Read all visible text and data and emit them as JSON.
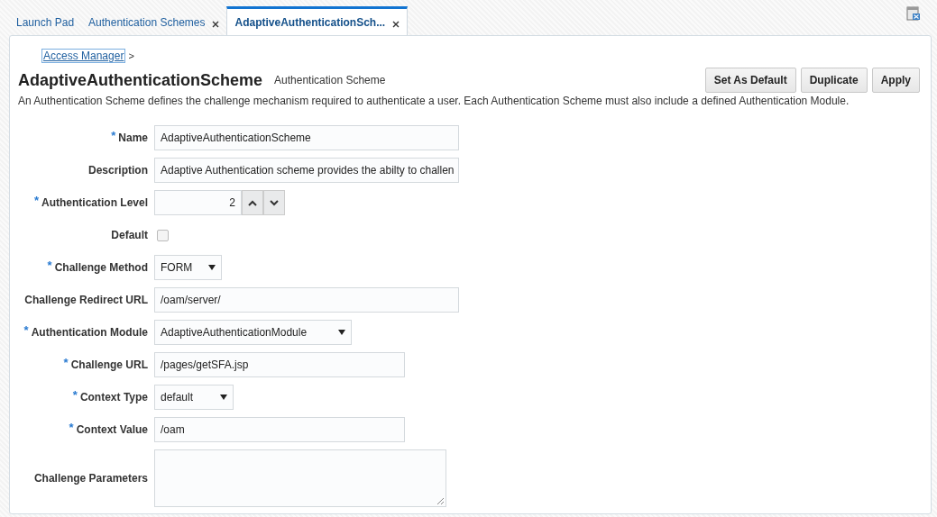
{
  "tabs": [
    {
      "label": "Launch Pad",
      "selected": false,
      "closable": false
    },
    {
      "label": "Authentication Schemes",
      "selected": false,
      "closable": true
    },
    {
      "label": "AdaptiveAuthenticationSch...",
      "selected": true,
      "closable": true
    }
  ],
  "breadcrumb": {
    "link": "Access Manager",
    "separator": ">"
  },
  "header": {
    "title": "AdaptiveAuthenticationScheme",
    "subtitle": "Authentication Scheme",
    "description": "An Authentication Scheme defines the challenge mechanism required to authenticate a user. Each Authentication Scheme must also include a defined Authentication Module."
  },
  "buttons": [
    "Set As Default",
    "Duplicate",
    "Apply"
  ],
  "fields": [
    {
      "kind": "text",
      "label": "Name",
      "required_mark": "*",
      "value": "AdaptiveAuthenticationScheme"
    },
    {
      "kind": "text",
      "label": "Description",
      "value": "Adaptive Authentication scheme provides the abilty to challen"
    },
    {
      "kind": "number",
      "label": "Authentication Level",
      "required_mark": "*",
      "value": "2"
    },
    {
      "kind": "checkbox",
      "label": "Default",
      "checked": false
    },
    {
      "kind": "select",
      "label": "Challenge Method",
      "required_mark": "*",
      "value": "FORM"
    },
    {
      "kind": "text",
      "label": "Challenge Redirect URL",
      "value": "/oam/server/"
    },
    {
      "kind": "select",
      "label": "Authentication Module",
      "required_mark": "*",
      "value": "AdaptiveAuthenticationModule"
    },
    {
      "kind": "text",
      "label": "Challenge URL",
      "required_mark": "*",
      "value": "/pages/getSFA.jsp"
    },
    {
      "kind": "select",
      "label": "Context Type",
      "required_mark": "*",
      "value": "default"
    },
    {
      "kind": "text",
      "label": "Context Value",
      "required_mark": "*",
      "value": "/oam"
    },
    {
      "kind": "textarea",
      "label": "Challenge Parameters"
    }
  ]
}
